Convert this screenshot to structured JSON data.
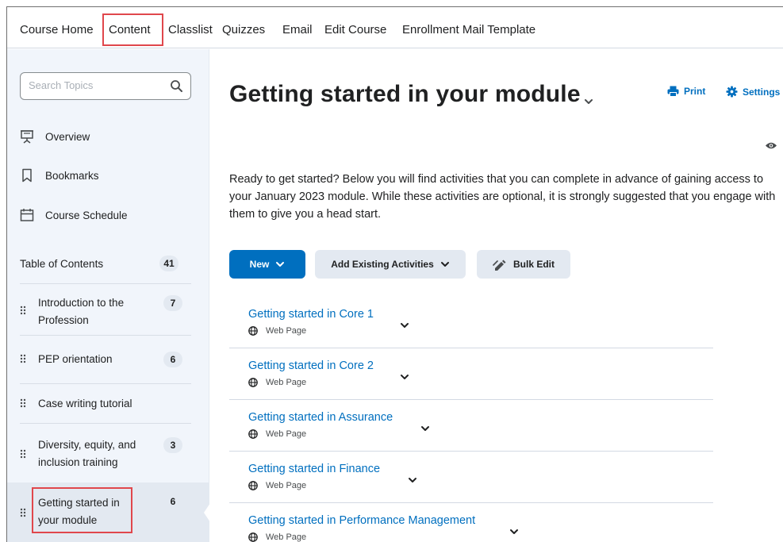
{
  "nav": {
    "items": [
      "Course Home",
      "Content",
      "Classlist",
      "Quizzes",
      "Email",
      "Edit Course",
      "Enrollment Mail Template"
    ],
    "active": "Content"
  },
  "sidebar": {
    "search_placeholder": "Search Topics",
    "links": [
      {
        "label": "Overview",
        "icon": "presentation-icon"
      },
      {
        "label": "Bookmarks",
        "icon": "bookmark-icon"
      },
      {
        "label": "Course Schedule",
        "icon": "calendar-icon"
      }
    ],
    "toc": {
      "label": "Table of Contents",
      "count": "41"
    },
    "modules": [
      {
        "label": "Introduction to the Profession",
        "count": "7"
      },
      {
        "label": "PEP orientation",
        "count": "6"
      },
      {
        "label": "Case writing tutorial",
        "count": ""
      },
      {
        "label": "Diversity, equity, and inclusion training",
        "count": "3"
      },
      {
        "label": "Getting started in your module",
        "count": "6",
        "selected": true
      }
    ]
  },
  "main": {
    "title": "Getting started in your module",
    "print_label": "Print",
    "settings_label": "Settings",
    "description": "Ready to get started? Below you will find activities that you can complete in advance of gaining access to your January 2023 module. While these activities are optional, it is strongly suggested that you engage with them to give you a head start.",
    "buttons": {
      "new": "New",
      "add_existing": "Add Existing Activities",
      "bulk_edit": "Bulk Edit"
    },
    "topics": [
      {
        "title": "Getting started in Core 1",
        "type": "Web Page"
      },
      {
        "title": "Getting started in Core 2",
        "type": "Web Page"
      },
      {
        "title": "Getting started in Assurance",
        "type": "Web Page"
      },
      {
        "title": "Getting started in Finance",
        "type": "Web Page"
      },
      {
        "title": "Getting started in Performance Management",
        "type": "Web Page"
      }
    ]
  },
  "colors": {
    "link": "#006fbf",
    "highlight": "#e0474c",
    "sidebar_bg": "#f1f5fb",
    "badge_bg": "#e3e9f1"
  }
}
